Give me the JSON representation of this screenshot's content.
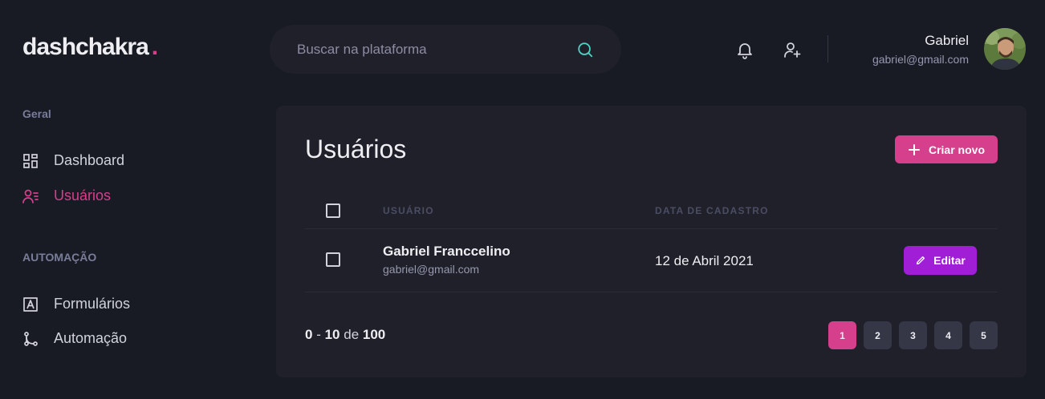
{
  "header": {
    "logo_text": "dashchakra",
    "logo_dot": ".",
    "search_placeholder": "Buscar na plataforma",
    "user_name": "Gabriel",
    "user_email": "gabriel@gmail.com"
  },
  "sidebar": {
    "sections": [
      {
        "title": "Geral",
        "items": [
          {
            "label": "Dashboard",
            "icon": "dashboard-icon",
            "active": false
          },
          {
            "label": "Usuários",
            "icon": "users-icon",
            "active": true
          }
        ]
      },
      {
        "title": "AUTOMAÇÃO",
        "items": [
          {
            "label": "Formulários",
            "icon": "form-icon",
            "active": false
          },
          {
            "label": "Automação",
            "icon": "git-merge-icon",
            "active": false
          }
        ]
      }
    ]
  },
  "main": {
    "title": "Usuários",
    "create_button": "Criar novo",
    "table": {
      "columns": [
        "USUÁRIO",
        "DATA DE CADASTRO"
      ],
      "rows": [
        {
          "name": "Gabriel Franccelino",
          "email": "gabriel@gmail.com",
          "date": "12 de Abril 2021",
          "action": "Editar"
        }
      ]
    },
    "pagination": {
      "from": "0",
      "to": "10",
      "of_label": "de",
      "total": "100",
      "pages": [
        "1",
        "2",
        "3",
        "4",
        "5"
      ],
      "current": "1"
    }
  },
  "colors": {
    "background": "#181B23",
    "panel": "#1F2029",
    "accent_pink": "#D53F8C",
    "accent_purple": "#9F1ED6",
    "search_icon": "#4FD1C5"
  }
}
